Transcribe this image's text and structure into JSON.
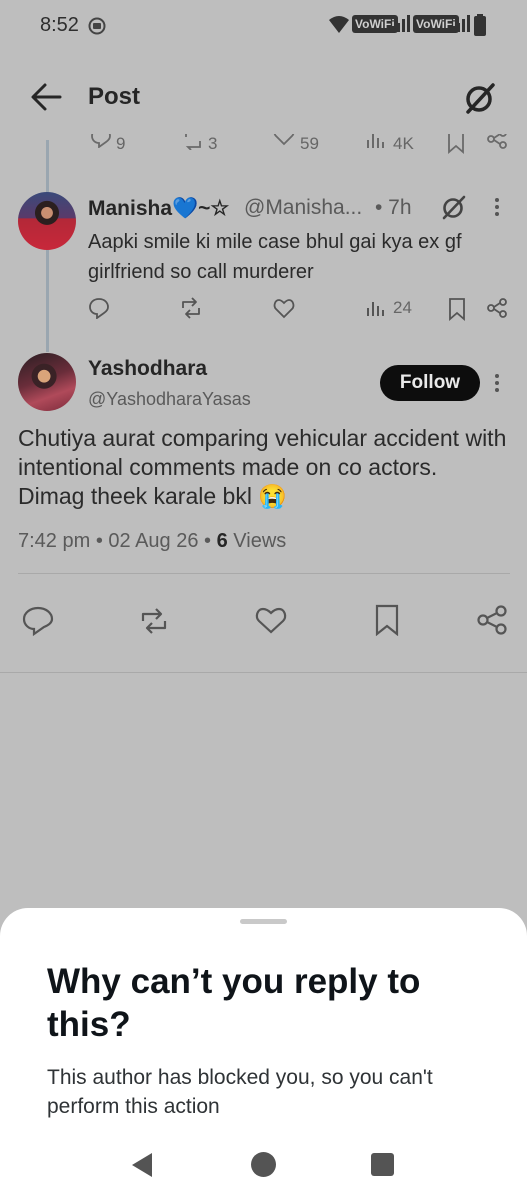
{
  "status_bar": {
    "time": "8:52",
    "vowifi_1": "VoWiFi",
    "vowifi_2": "VoWiFi"
  },
  "header": {
    "title": "Post"
  },
  "previous_actions": {
    "replies": "9",
    "reposts": "3",
    "likes": "59",
    "views": "4K"
  },
  "reply": {
    "name": "Manisha💙~☆",
    "handle": "@Manisha...",
    "time": "• 7h",
    "text": "Aapki smile ki  mile case bhul gai kya ex gf girlfriend so call murderer",
    "views": "24"
  },
  "main_post": {
    "name": "Yashodhara",
    "handle": "@YashodharaYasas",
    "follow_label": "Follow",
    "text": "Chutiya aurat comparing vehicular accident with intentional comments made on co actors. Dimag theek karale bkl 😭",
    "meta_time": "7:42 pm • 02 Aug 26 • ",
    "meta_views_count": "6",
    "meta_views_label": " Views"
  },
  "sheet": {
    "title": "Why can’t you reply to this?",
    "message": "This author has blocked you, so you can't perform this action"
  },
  "colors": {
    "overlay": "#bebebe",
    "sheet": "#ffffff",
    "follow_bg": "#0d0d0d"
  }
}
